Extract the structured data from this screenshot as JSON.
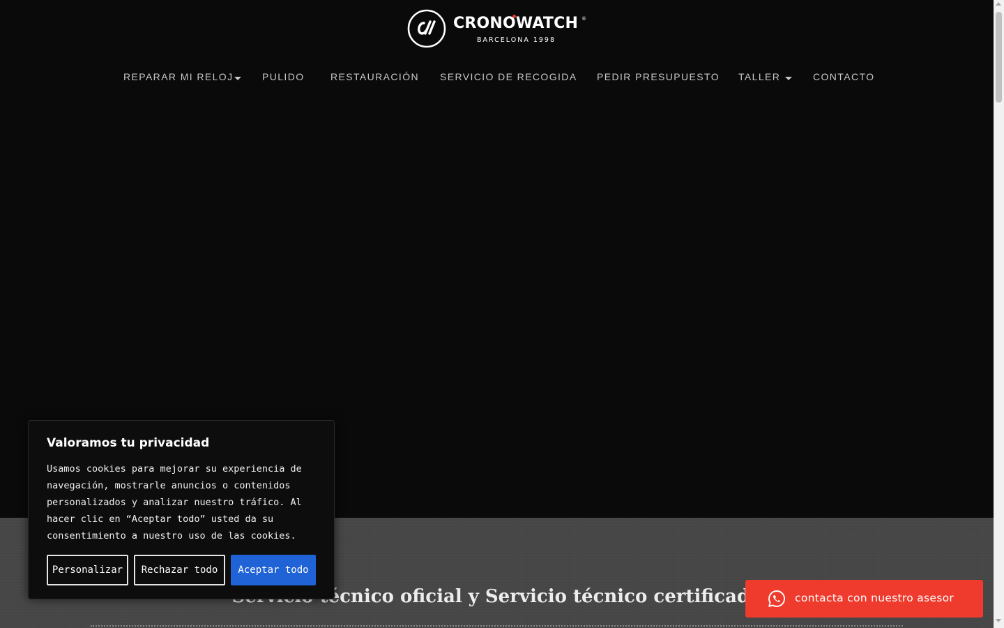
{
  "brand": {
    "name": "CRONOWATCH",
    "registered": "®",
    "tagline": "BARCELONA 1998",
    "logo_icon": "cw-monogram-icon"
  },
  "nav": {
    "items": [
      {
        "label": "REPARAR MI RELOJ",
        "has_dropdown": true
      },
      {
        "label": "PULIDO",
        "has_dropdown": false
      },
      {
        "label": "RESTAURACIÓN",
        "has_dropdown": false
      },
      {
        "label": "SERVICIO DE RECOGIDA",
        "has_dropdown": false
      },
      {
        "label": "PEDIR PRESUPUESTO",
        "has_dropdown": false
      },
      {
        "label": "TALLER",
        "has_dropdown": true
      },
      {
        "label": "CONTACTO",
        "has_dropdown": false
      }
    ]
  },
  "section": {
    "title": "Servicio técnico oficial y Servicio técnico certificado"
  },
  "cookie_banner": {
    "title": "Valoramos tu privacidad",
    "text": "Usamos cookies para mejorar su experiencia de navegación, mostrarle anuncios o contenidos personalizados y analizar nuestro tráfico. Al hacer clic en “Aceptar todo” usted da su consentimiento a nuestro uso de las cookies.",
    "customize_label": "Personalizar",
    "reject_label": "Rechazar todo",
    "accept_label": "Aceptar todo"
  },
  "whatsapp": {
    "label": "contacta con nuestro asesor",
    "icon": "whatsapp-icon"
  },
  "colors": {
    "background": "#0a0a0a",
    "section_bg": "#464646",
    "accent_red": "#ef3b2d",
    "accept_blue": "#1f63d6"
  }
}
